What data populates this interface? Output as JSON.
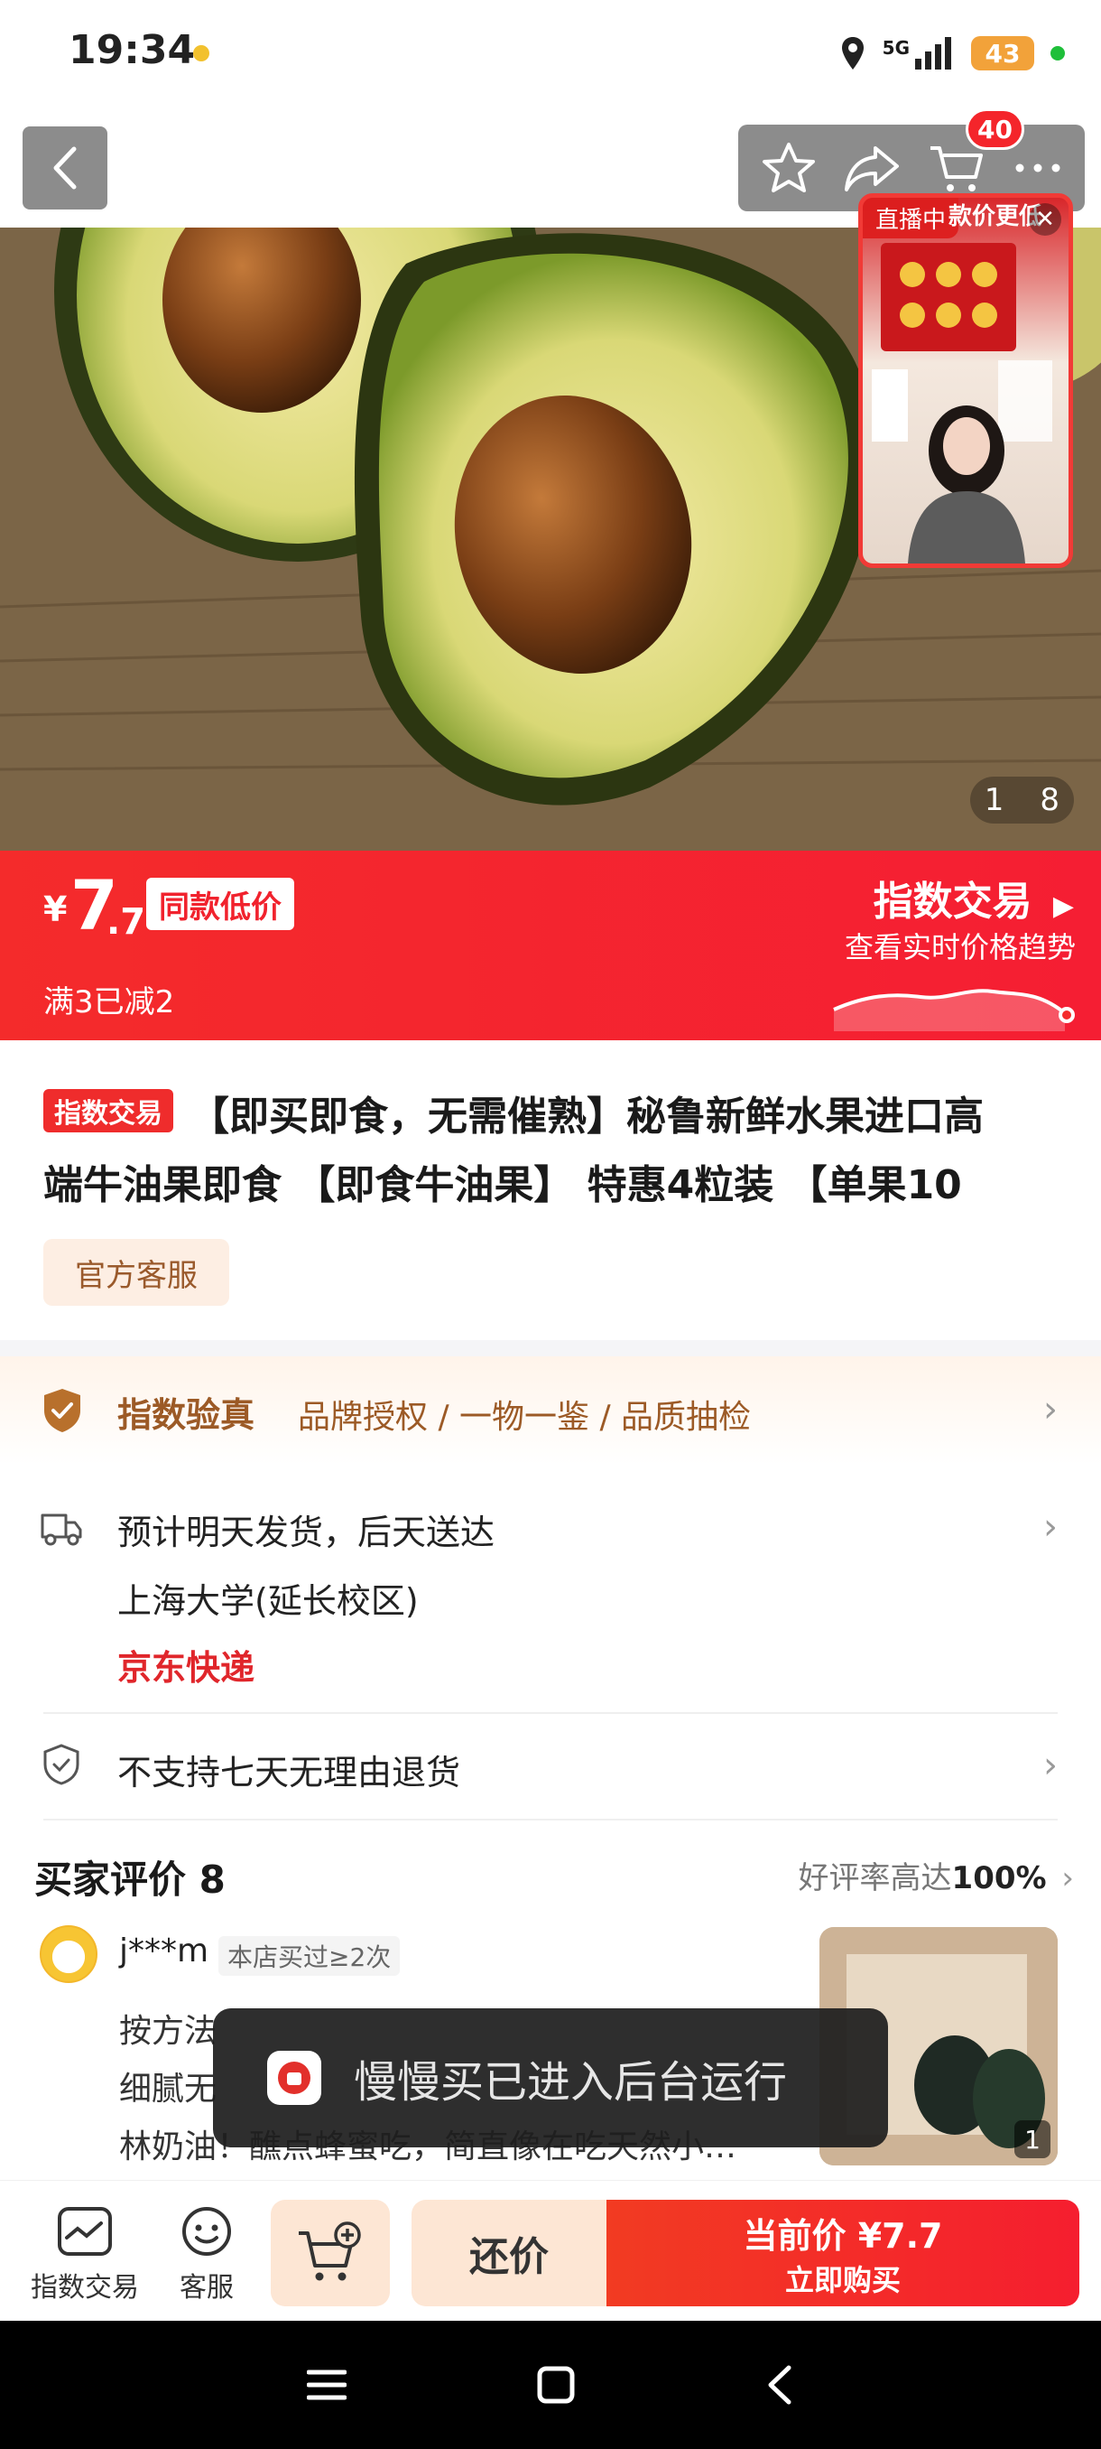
{
  "status_bar": {
    "time": "19:34",
    "network": "5G",
    "battery": "43"
  },
  "nav": {
    "cart_count": "40"
  },
  "gallery": {
    "current": "1",
    "total": "8"
  },
  "live": {
    "tag": "直播中",
    "banner": "款价更低"
  },
  "price": {
    "currency": "¥",
    "integer": "7",
    "decimal": ".7",
    "badge": "同款低价",
    "promo": "满3已减2",
    "index_trade": "指数交易",
    "index_sub": "查看实时价格趋势"
  },
  "product": {
    "tag": "指数交易",
    "title_line1": "【即买即食，无需催熟】秘鲁新鲜水果进口高",
    "title_line2": "端牛油果即食 【即食牛油果】 特惠4粒装 【单果10",
    "service": "官方客服"
  },
  "verify": {
    "title": "指数验真",
    "items": "品牌授权 / 一物一鉴 / 品质抽检"
  },
  "shipping": {
    "eta": "预计明天发货，后天送达",
    "address": "上海大学(延长校区)",
    "carrier": "京东快递"
  },
  "returns": {
    "text": "不支持七天无理由退货"
  },
  "reviews": {
    "title": "买家评价 8",
    "rate_label": "好评率高达",
    "rate_value": "100%",
    "reviewer": "j***m",
    "buyer_badge": "本店买过≥2次",
    "lines": [
      "按方法",
      "细腻无",
      "林奶油！醮点蜂蜜吃，简直像在吃天然小…"
    ],
    "image_count": "1"
  },
  "toast": {
    "text": "慢慢买已进入后台运行"
  },
  "bottom": {
    "index_trade": "指数交易",
    "service": "客服",
    "bargain": "还价",
    "buy_price": "当前价 ¥7.7",
    "buy_label": "立即购买"
  },
  "colors": {
    "accent_red": "#f42b2b",
    "brown": "#9c5a26",
    "peach": "#fde6d4"
  }
}
